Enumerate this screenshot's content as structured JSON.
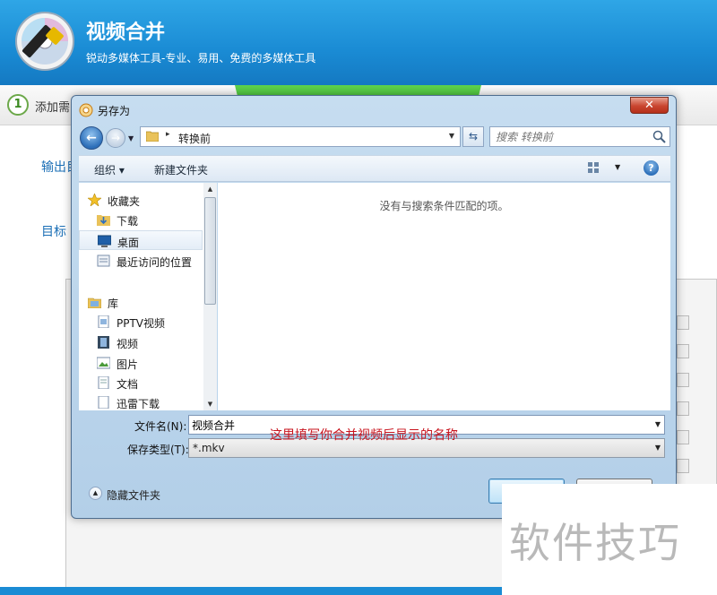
{
  "app": {
    "title": "视频合并",
    "subtitle": "锐动多媒体工具-专业、易用、免费的多媒体工具",
    "step1_number": "1",
    "step1_label": "添加需",
    "output_label": "输出目",
    "target_label": "目标"
  },
  "dialog": {
    "title": "另存为",
    "close_label": "✕",
    "address": {
      "breadcrumb_sep": "▸",
      "current_folder": "转换前"
    },
    "search_placeholder": "搜索 转换前",
    "toolbar": {
      "organize_label": "组织 ▾",
      "new_folder_label": "新建文件夹",
      "help_label": "?"
    },
    "nav": {
      "favorites_header": "收藏夹",
      "favorites": [
        "下载",
        "桌面",
        "最近访问的位置"
      ],
      "libraries_header": "库",
      "libraries": [
        "PPTV视频",
        "视频",
        "图片",
        "文档",
        "迅雷下载"
      ],
      "selected": "桌面"
    },
    "empty_message": "没有与搜索条件匹配的项。",
    "filename_label": "文件名(N):",
    "filename_value": "视频合并",
    "filetype_label": "保存类型(T):",
    "filetype_value": "*.mkv",
    "hide_folders_label": "隐藏文件夹",
    "save_label": "保存(S)",
    "cancel_label": "取消"
  },
  "annotation": "这里填写你合并视频后显示的名称",
  "watermark": "软件技巧"
}
